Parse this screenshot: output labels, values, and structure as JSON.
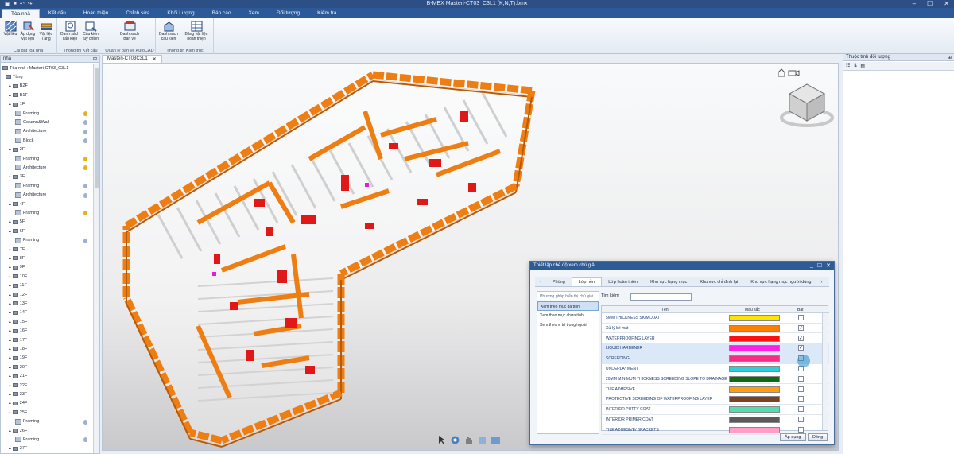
{
  "window": {
    "title": "B-MEX Masteri-CT03_C3L1 (K,N,T).bmx",
    "controls": [
      "–",
      "☐",
      "✕"
    ]
  },
  "ribbon_tabs": [
    "Tòa nhà",
    "Kết cấu",
    "Hoàn thiện",
    "Chỉnh sửa",
    "Khối Lượng",
    "Báo cáo",
    "Xem",
    "Đối tượng",
    "Kiểm tra"
  ],
  "ribbon_groups": [
    {
      "caption": "Cài đặt tòa nhà",
      "buttons": [
        "Vật liệu",
        "Áp dụng vật liệu",
        "Vật liệu Tầng"
      ]
    },
    {
      "caption": "Thông tin Kết cấu",
      "buttons": [
        "Danh sách cấu kiện",
        "Cấu kiện tùy chỉnh"
      ]
    },
    {
      "caption": "Quản lý bản vẽ AutoCAD",
      "buttons": [
        "Danh sách Bản vẽ"
      ]
    },
    {
      "caption": "Thông tin Kiến trúc",
      "buttons": [
        "Danh sách cấu kiện",
        "Bảng vật liệu hoàn thiện"
      ]
    }
  ],
  "left_panel": {
    "title": "nhà",
    "tree": [
      {
        "label": "Tòa nhà : Masteri-CT03_C3L1",
        "level": 0,
        "kind": "root"
      },
      {
        "label": "Tầng",
        "level": 1,
        "kind": "floor"
      },
      {
        "label": "B2F",
        "level": 2,
        "kind": "floor"
      },
      {
        "label": "B1F",
        "level": 2,
        "kind": "floor"
      },
      {
        "label": "1F",
        "level": 2,
        "kind": "floor"
      },
      {
        "label": "Framing",
        "level": 3,
        "kind": "layer",
        "bulb": "on"
      },
      {
        "label": "Column&Wall",
        "level": 3,
        "kind": "layer",
        "bulb": "off"
      },
      {
        "label": "Architecture",
        "level": 3,
        "kind": "layer",
        "bulb": "off"
      },
      {
        "label": "Block",
        "level": 3,
        "kind": "layer",
        "bulb": "off"
      },
      {
        "label": "2F",
        "level": 2,
        "kind": "floor"
      },
      {
        "label": "Framing",
        "level": 3,
        "kind": "layer",
        "bulb": "on"
      },
      {
        "label": "Architecture",
        "level": 3,
        "kind": "layer",
        "bulb": "on"
      },
      {
        "label": "3F",
        "level": 2,
        "kind": "floor"
      },
      {
        "label": "Framing",
        "level": 3,
        "kind": "layer",
        "bulb": "off"
      },
      {
        "label": "Architecture",
        "level": 3,
        "kind": "layer",
        "bulb": "off"
      },
      {
        "label": "4F",
        "level": 2,
        "kind": "floor"
      },
      {
        "label": "Framing",
        "level": 3,
        "kind": "layer",
        "bulb": "on"
      },
      {
        "label": "5F",
        "level": 2,
        "kind": "floor"
      },
      {
        "label": "6F",
        "level": 2,
        "kind": "floor"
      },
      {
        "label": "Framing",
        "level": 3,
        "kind": "layer",
        "bulb": "off"
      },
      {
        "label": "7F",
        "level": 2,
        "kind": "floor"
      },
      {
        "label": "8F",
        "level": 2,
        "kind": "floor"
      },
      {
        "label": "9F",
        "level": 2,
        "kind": "floor"
      },
      {
        "label": "10F",
        "level": 2,
        "kind": "floor"
      },
      {
        "label": "11F",
        "level": 2,
        "kind": "floor"
      },
      {
        "label": "12F",
        "level": 2,
        "kind": "floor"
      },
      {
        "label": "13F",
        "level": 2,
        "kind": "floor"
      },
      {
        "label": "14F",
        "level": 2,
        "kind": "floor"
      },
      {
        "label": "15F",
        "level": 2,
        "kind": "floor"
      },
      {
        "label": "16F",
        "level": 2,
        "kind": "floor"
      },
      {
        "label": "17F",
        "level": 2,
        "kind": "floor"
      },
      {
        "label": "18F",
        "level": 2,
        "kind": "floor"
      },
      {
        "label": "19F",
        "level": 2,
        "kind": "floor"
      },
      {
        "label": "20F",
        "level": 2,
        "kind": "floor"
      },
      {
        "label": "21F",
        "level": 2,
        "kind": "floor"
      },
      {
        "label": "22F",
        "level": 2,
        "kind": "floor"
      },
      {
        "label": "23F",
        "level": 2,
        "kind": "floor"
      },
      {
        "label": "24F",
        "level": 2,
        "kind": "floor"
      },
      {
        "label": "25F",
        "level": 2,
        "kind": "floor"
      },
      {
        "label": "Framing",
        "level": 3,
        "kind": "layer",
        "bulb": "off"
      },
      {
        "label": "26F",
        "level": 2,
        "kind": "floor"
      },
      {
        "label": "Framing",
        "level": 3,
        "kind": "layer",
        "bulb": "off"
      },
      {
        "label": "27F",
        "level": 2,
        "kind": "floor"
      }
    ]
  },
  "doc_tab": {
    "label": "Masteri-CT03C3L1",
    "close": "✕"
  },
  "viewport": {
    "model_colors": {
      "wall": "#ee7d12",
      "wall_dark": "#b95a06",
      "floor_line": "#d8d8d8",
      "red_layer": "#e01818",
      "magenta": "#e21de0"
    },
    "nav_icons": [
      "home-icon",
      "camera-icon"
    ],
    "bottom_tools": [
      "select-icon",
      "orbit-icon",
      "pan-icon",
      "zoom-icon",
      "fit-icon"
    ]
  },
  "right_panel": {
    "title": "Thuộc tính đối tượng"
  },
  "dialog": {
    "title": "Thiết lập chế độ xem chú giải",
    "tabs": [
      "Phòng",
      "Lớp nền",
      "Lớp hoàn thiện",
      "Khu vực hạng mục",
      "Khu vực chỉ định lại",
      "Khu vực hạng mục người dùng"
    ],
    "active_tab": "Lớp nền",
    "left_list": [
      "Phương pháp hiển thị chú giải",
      "Xem theo mục đã tính",
      "Xem theo mục chưa tính",
      "Xem theo vị trí trong/ngoài"
    ],
    "selected_left": "Xem theo mục đã tính",
    "search_label": "Tìm kiếm",
    "search_value": "",
    "columns": [
      "Tên",
      "Màu sắc",
      "Bật"
    ],
    "rows": [
      {
        "name": "5MM THICKNESS SKIMCOAT",
        "color": "#ffe400",
        "checked": false
      },
      {
        "name": "Xử lý bề mặt",
        "color": "#ff7f00",
        "checked": true
      },
      {
        "name": "WATERPROOFING LAYER",
        "color": "#ff1010",
        "checked": true
      },
      {
        "name": "LIQUID HARDENER",
        "color": "#ff20e8",
        "checked": true
      },
      {
        "name": "SCREEDING",
        "color": "#f82a84",
        "checked": false
      },
      {
        "name": "UNDERLAYMENT",
        "color": "#2bd0e0",
        "checked": false
      },
      {
        "name": "20MM MINIMUM THICKNESS SCREEDING SLOPE TO DRAINAGE",
        "color": "#0f6a14",
        "checked": false
      },
      {
        "name": "TILE ADHESIVE",
        "color": "#ff9f10",
        "checked": false
      },
      {
        "name": "PROTECTIVE SCREEDING OF WATERPROOFING LAYER",
        "color": "#7a4222",
        "checked": false
      },
      {
        "name": "INTERIOR PUTTY COAT",
        "color": "#53ddb0",
        "checked": false
      },
      {
        "name": "INTERIOR PRIMER COAT",
        "color": "#5a5a5a",
        "checked": false
      },
      {
        "name": "TILE ADHESIVE/ BRACKETS",
        "color": "#ff9fc8",
        "checked": false
      }
    ],
    "buttons": [
      "Áp dụng",
      "Đóng"
    ]
  }
}
